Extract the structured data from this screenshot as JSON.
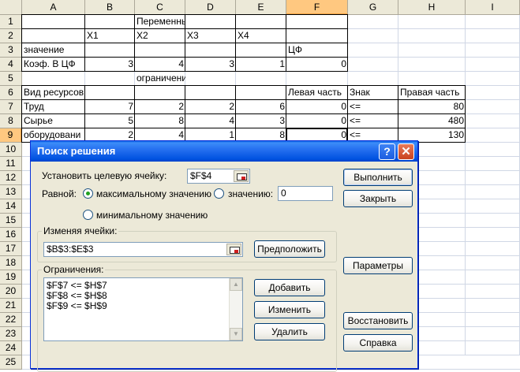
{
  "sheet": {
    "columns": [
      "A",
      "B",
      "C",
      "D",
      "E",
      "F",
      "G",
      "H",
      "I"
    ],
    "rows": [
      "1",
      "2",
      "3",
      "4",
      "5",
      "6",
      "7",
      "8",
      "9",
      "10",
      "11",
      "12",
      "13",
      "14",
      "15",
      "16",
      "17",
      "18",
      "19",
      "20",
      "21",
      "22",
      "23",
      "24",
      "25"
    ],
    "cells": {
      "C1": "Переменные",
      "B2": "X1",
      "C2": "X2",
      "D2": "X3",
      "E2": "X4",
      "A3": "значение",
      "F3": "ЦФ",
      "A4": "Коэф. В ЦФ",
      "B4": "3",
      "C4": "4",
      "D4": "3",
      "E4": "1",
      "F4": "0",
      "C5": "ограничения",
      "A6": "Вид ресурсов",
      "F6": "Левая часть",
      "G6": "Знак",
      "H6": "Правая часть",
      "A7": "Труд",
      "B7": "7",
      "C7": "2",
      "D7": "2",
      "E7": "6",
      "F7": "0",
      "G7": "<=",
      "H7": "80",
      "A8": "Сырье",
      "B8": "5",
      "C8": "8",
      "D8": "4",
      "E8": "3",
      "F8": "0",
      "G8": "<=",
      "H8": "480",
      "A9": "оборудовани",
      "B9": "2",
      "C9": "4",
      "D9": "1",
      "E9": "8",
      "F9": "0",
      "G9": "<=",
      "H9": "130"
    },
    "active_cell": "F9"
  },
  "dialog": {
    "title": "Поиск решения",
    "help_icon_glyph": "?",
    "close_icon_glyph": "✕",
    "target_label": "Установить целевую ячейку:",
    "target_value": "$F$4",
    "equal_label": "Равной:",
    "radio_max": "максимальному значению",
    "radio_value": "значению:",
    "value_field": "0",
    "radio_min": "минимальному значению",
    "radio_selected": "max",
    "changing_title": "Изменяя ячейки:",
    "changing_value": "$B$3:$E$3",
    "guess_button": "Предположить",
    "constraints_title": "Ограничения:",
    "constraints": [
      "$F$7 <= $H$7",
      "$F$8 <= $H$8",
      "$F$9 <= $H$9"
    ],
    "add_button": "Добавить",
    "change_button": "Изменить",
    "delete_button": "Удалить",
    "solve_button": "Выполнить",
    "close_button": "Закрыть",
    "options_button": "Параметры",
    "reset_button": "Восстановить",
    "help_button": "Справка"
  }
}
